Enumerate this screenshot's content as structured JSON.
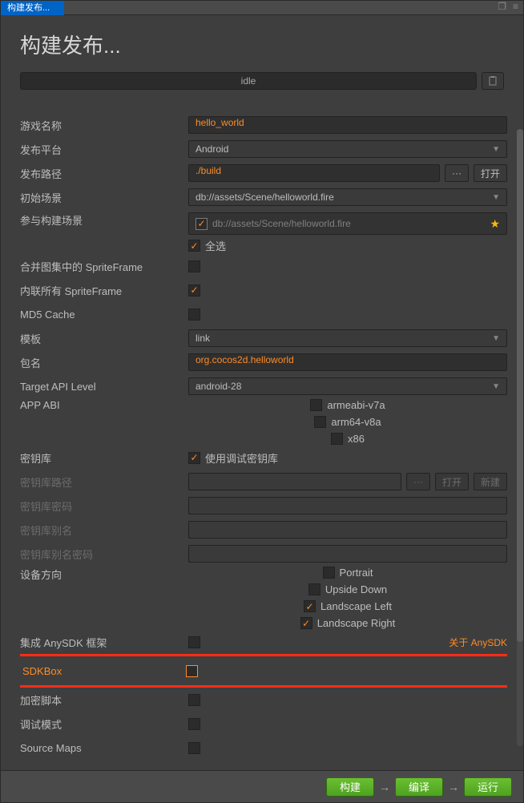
{
  "titlebar": {
    "tab": "构建发布..."
  },
  "page_title": "构建发布...",
  "status": {
    "text": "idle"
  },
  "form": {
    "game_name": {
      "label": "游戏名称",
      "value": "hello_world"
    },
    "platform": {
      "label": "发布平台",
      "value": "Android"
    },
    "publish_path": {
      "label": "发布路径",
      "value": "./build",
      "browse": "···",
      "open": "打开"
    },
    "initial_scene": {
      "label": "初始场景",
      "value": "db://assets/Scene/helloworld.fire"
    },
    "scenes": {
      "label": "参与构建场景",
      "item": "db://assets/Scene/helloworld.fire",
      "select_all": "全选"
    },
    "merge_spriteframe": {
      "label": "合并图集中的 SpriteFrame",
      "checked": false
    },
    "inline_spriteframe": {
      "label": "内联所有 SpriteFrame",
      "checked": true
    },
    "md5": {
      "label": "MD5 Cache",
      "checked": false
    },
    "template": {
      "label": "模板",
      "value": "link"
    },
    "package": {
      "label": "包名",
      "value": "org.cocos2d.helloworld"
    },
    "api_level": {
      "label": "Target API Level",
      "value": "android-28"
    },
    "app_abi": {
      "label": "APP ABI",
      "options": [
        {
          "label": "armeabi-v7a",
          "checked": false
        },
        {
          "label": "arm64-v8a",
          "checked": false
        },
        {
          "label": "x86",
          "checked": false
        }
      ]
    },
    "keystore": {
      "label": "密钥库",
      "use_debug_label": "使用调试密钥库",
      "use_debug": true
    },
    "keystore_path": {
      "label": "密钥库路径",
      "browse": "···",
      "open": "打开",
      "new": "新建"
    },
    "keystore_pwd": {
      "label": "密钥库密码"
    },
    "keystore_alias": {
      "label": "密钥库别名"
    },
    "keystore_alias_pwd": {
      "label": "密钥库别名密码"
    },
    "orientation": {
      "label": "设备方向",
      "options": [
        {
          "label": "Portrait",
          "checked": false
        },
        {
          "label": "Upside Down",
          "checked": false
        },
        {
          "label": "Landscape Left",
          "checked": true
        },
        {
          "label": "Landscape Right",
          "checked": true
        }
      ]
    },
    "anysdk": {
      "label": "集成 AnySDK 框架",
      "checked": false,
      "link": "关于 AnySDK"
    },
    "sdkbox": {
      "label": "SDKBox",
      "checked": false
    },
    "encrypt": {
      "label": "加密脚本",
      "checked": false
    },
    "debug_mode": {
      "label": "调试模式",
      "checked": false
    },
    "source_maps": {
      "label": "Source Maps",
      "checked": false
    }
  },
  "footer": {
    "build": "构建",
    "compile": "编译",
    "run": "运行"
  }
}
